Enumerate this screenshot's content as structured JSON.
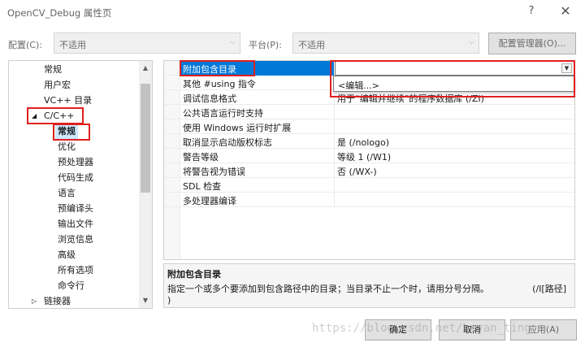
{
  "window": {
    "title": "OpenCV_Debug 属性页",
    "help": "?",
    "close": "✕"
  },
  "config_bar": {
    "config_label": "配置(C):",
    "config_value": "不适用",
    "platform_label": "平台(P):",
    "platform_value": "不适用",
    "manager_button": "配置管理器(O)..."
  },
  "tree": {
    "items": [
      {
        "label": "常规"
      },
      {
        "label": "用户宏"
      },
      {
        "label": "VC++ 目录"
      },
      {
        "label": "C/C++",
        "expander": "◢"
      },
      {
        "label": "常规"
      },
      {
        "label": "优化"
      },
      {
        "label": "预处理器"
      },
      {
        "label": "代码生成"
      },
      {
        "label": "语言"
      },
      {
        "label": "预编译头"
      },
      {
        "label": "输出文件"
      },
      {
        "label": "浏览信息"
      },
      {
        "label": "高级"
      },
      {
        "label": "所有选项"
      },
      {
        "label": "命令行"
      },
      {
        "label": "链接器",
        "expander": "▷"
      }
    ]
  },
  "grid": {
    "rows": [
      {
        "name": "附加包含目录",
        "value": ""
      },
      {
        "name": "其他 #using 指令",
        "value": ""
      },
      {
        "name": "调试信息格式",
        "value": "用于“编辑并继续”的程序数据库 (/ZI)"
      },
      {
        "name": "公共语言运行时支持",
        "value": ""
      },
      {
        "name": "使用 Windows 运行时扩展",
        "value": ""
      },
      {
        "name": "取消显示启动版权标志",
        "value": "是 (/nologo)"
      },
      {
        "name": "警告等级",
        "value": "等级 1 (/W1)"
      },
      {
        "name": "将警告视为错误",
        "value": "否 (/WX-)"
      },
      {
        "name": "SDL 检查",
        "value": ""
      },
      {
        "name": "多处理器编译",
        "value": ""
      }
    ],
    "dropdown_option": "<编辑...>"
  },
  "description": {
    "title": "附加包含目录",
    "text": "指定一个或多个要添加到包含路径中的目录；当目录不止一个时，请用分号分隔。",
    "switch": "(/I[路径]",
    "text2": ")"
  },
  "buttons": {
    "ok": "确定",
    "cancel": "取消",
    "apply": "应用(A)"
  },
  "watermark": "https://blog.csdn.net/bryan_ting"
}
